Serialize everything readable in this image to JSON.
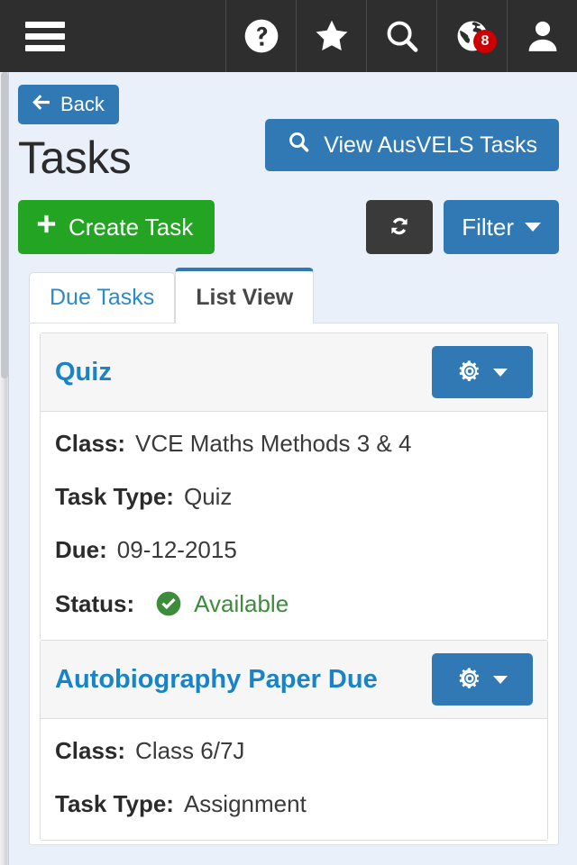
{
  "topbar": {
    "menu_icon": "hamburger-menu-icon",
    "icons": [
      {
        "name": "help-icon",
        "label": "Help"
      },
      {
        "name": "star-icon",
        "label": "Favourites"
      },
      {
        "name": "search-icon",
        "label": "Search"
      },
      {
        "name": "globe-icon",
        "label": "Notifications",
        "badge": "8"
      },
      {
        "name": "user-icon",
        "label": "Account"
      }
    ]
  },
  "header": {
    "back_label": "Back",
    "title": "Tasks",
    "ausvels_label": "View AusVELS Tasks",
    "create_label": "Create Task",
    "refresh_label": "Refresh",
    "filter_label": "Filter"
  },
  "tabs": [
    {
      "label": "Due Tasks",
      "active": false
    },
    {
      "label": "List View",
      "active": true
    }
  ],
  "tasks": [
    {
      "title": "Quiz",
      "fields": [
        {
          "label": "Class:",
          "value": "VCE Maths Methods 3 & 4"
        },
        {
          "label": "Task Type:",
          "value": "Quiz"
        },
        {
          "label": "Due:",
          "value": "09-12-2015"
        }
      ],
      "status_label": "Status:",
      "status_value": "Available",
      "status_icon": "check-circle-icon"
    },
    {
      "title": "Autobiography Paper Due",
      "fields": [
        {
          "label": "Class:",
          "value": "Class 6/7J"
        },
        {
          "label": "Task Type:",
          "value": "Assignment"
        }
      ]
    }
  ],
  "colors": {
    "topbar_bg": "#2e2e2e",
    "page_bg": "#eaf0fa",
    "primary": "#3079b5",
    "success": "#23a423",
    "dark": "#3a3a3a",
    "link": "#1884c7",
    "badge": "#cc0000",
    "status_green": "#3c8c3c"
  }
}
